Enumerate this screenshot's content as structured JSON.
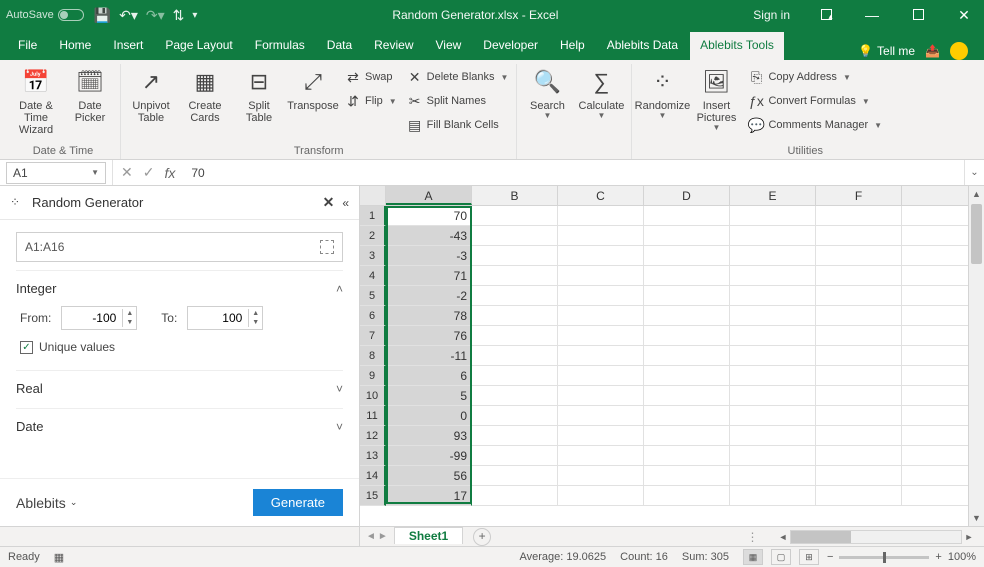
{
  "title": "Random Generator.xlsx - Excel",
  "titlebar": {
    "autosave_label": "AutoSave",
    "autosave_state": "Off",
    "signin": "Sign in"
  },
  "tabs": {
    "file": "File",
    "items": [
      "Home",
      "Insert",
      "Page Layout",
      "Formulas",
      "Data",
      "Review",
      "View",
      "Developer",
      "Help",
      "Ablebits Data",
      "Ablebits Tools"
    ],
    "active_index": 10,
    "tellme": "Tell me"
  },
  "ribbon": {
    "groups": [
      {
        "label": "Date & Time",
        "big": [
          {
            "name": "date-time-wizard-button",
            "icon": "📅",
            "lines": [
              "Date &",
              "Time Wizard"
            ]
          },
          {
            "name": "date-picker-button",
            "icon": "🗓",
            "lines": [
              "Date",
              "Picker"
            ]
          }
        ],
        "small": []
      },
      {
        "label": "Transform",
        "big": [
          {
            "name": "unpivot-table-button",
            "icon": "↗",
            "lines": [
              "Unpivot",
              "Table"
            ]
          },
          {
            "name": "create-cards-button",
            "icon": "▦",
            "lines": [
              "Create",
              "Cards"
            ]
          },
          {
            "name": "split-table-button",
            "icon": "⊟",
            "lines": [
              "Split",
              "Table"
            ]
          },
          {
            "name": "transpose-button",
            "icon": "⤢",
            "lines": [
              "Transpose",
              ""
            ]
          }
        ],
        "small": [
          {
            "name": "swap-button",
            "icon": "⇄",
            "label": "Swap",
            "drop": false
          },
          {
            "name": "flip-button",
            "icon": "⇵",
            "label": "Flip",
            "drop": true
          }
        ],
        "small2": [
          {
            "name": "delete-blanks-button",
            "icon": "✕",
            "label": "Delete Blanks",
            "drop": true
          },
          {
            "name": "split-names-button",
            "icon": "✂",
            "label": "Split Names",
            "drop": false
          },
          {
            "name": "fill-blank-cells-button",
            "icon": "▤",
            "label": "Fill Blank Cells",
            "drop": false
          }
        ]
      },
      {
        "label": "",
        "big": [
          {
            "name": "search-button",
            "icon": "🔍",
            "lines": [
              "Search",
              ""
            ],
            "drop": true
          },
          {
            "name": "calculate-button",
            "icon": "∑",
            "lines": [
              "Calculate",
              ""
            ],
            "drop": true
          }
        ]
      },
      {
        "label": "Utilities",
        "big": [
          {
            "name": "randomize-button",
            "icon": "⁘",
            "lines": [
              "Randomize",
              ""
            ],
            "drop": true
          },
          {
            "name": "insert-pictures-button",
            "icon": "🖼",
            "lines": [
              "Insert",
              "Pictures"
            ],
            "drop": true
          }
        ],
        "small": [
          {
            "name": "copy-address-button",
            "icon": "⎘",
            "label": "Copy Address",
            "drop": true
          },
          {
            "name": "convert-formulas-button",
            "icon": "ƒx",
            "label": "Convert Formulas",
            "drop": true
          },
          {
            "name": "comments-manager-button",
            "icon": "💬",
            "label": "Comments Manager",
            "drop": true
          }
        ]
      }
    ]
  },
  "formulabar": {
    "name": "A1",
    "value": "70"
  },
  "pane": {
    "title": "Random Generator",
    "range": "A1:A16",
    "sections": {
      "integer": {
        "label": "Integer",
        "expanded": true,
        "from_label": "From:",
        "from_value": "-100",
        "to_label": "To:",
        "to_value": "100",
        "unique_label": "Unique values",
        "unique_checked": true
      },
      "real": {
        "label": "Real",
        "expanded": false
      },
      "date": {
        "label": "Date",
        "expanded": false
      }
    },
    "brand": "Ablebits",
    "generate": "Generate"
  },
  "grid": {
    "columns": [
      "A",
      "B",
      "C",
      "D",
      "E",
      "F"
    ],
    "selected_col_index": 0,
    "row_count": 15,
    "dataA": [
      70,
      -43,
      -3,
      71,
      -2,
      78,
      76,
      -11,
      6,
      5,
      0,
      93,
      -99,
      56,
      17
    ],
    "selection": {
      "col": 0,
      "row_start": 0,
      "row_end": 15
    },
    "active_cell": {
      "row": 0,
      "col": 0
    }
  },
  "sheetbar": {
    "active_sheet": "Sheet1"
  },
  "statusbar": {
    "ready": "Ready",
    "average_label": "Average:",
    "average": "19.0625",
    "count_label": "Count:",
    "count": "16",
    "sum_label": "Sum:",
    "sum": "305",
    "zoom": "100%"
  }
}
